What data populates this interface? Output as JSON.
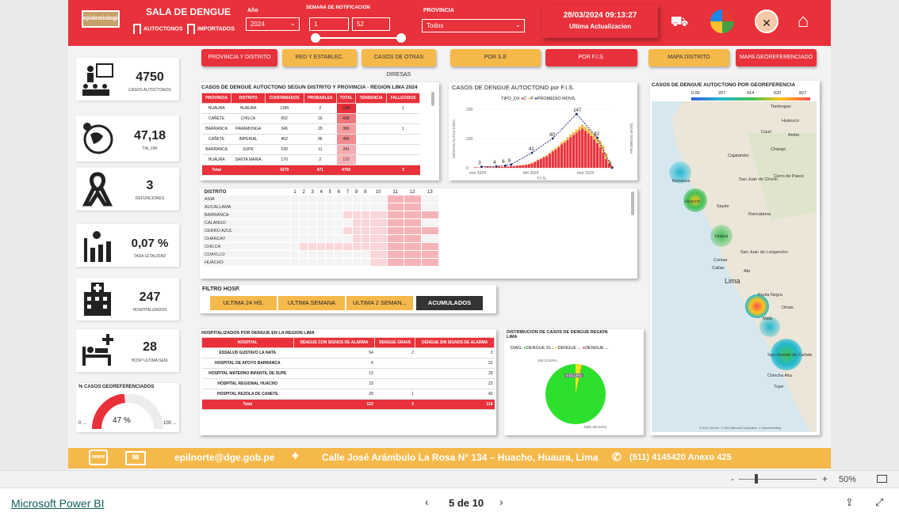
{
  "header": {
    "logo_text": "epidemiologia",
    "title": "SALA DE DENGUE",
    "filter_autoctonos": "AUTOCTONOS",
    "filter_importados": "IMPORTADOS",
    "year_label": "Año",
    "year_value": "2024",
    "week_label": "SEMANA DE NOTIFICACION",
    "week_from": "1",
    "week_to": "52",
    "province_label": "PROVINCIA",
    "province_value": "Todos",
    "datetime": "28/03/2024 09:13:27",
    "update_label": "Ultima Actualizacion"
  },
  "nav_buttons": [
    "PROVINCIA Y DISTRITO",
    "RED Y ESTABLEC.",
    "CASOS DE OTRAS DIRESAS",
    "POR S.E",
    "POR F.I.S.",
    "MAPA DISTRITO",
    "MAPA GEOREFERENCIADO"
  ],
  "kpis": {
    "casos": {
      "value": "4750",
      "label": "CASOS AUTOCTONOS"
    },
    "tia": {
      "value": "47,18",
      "label": "TIA_10K"
    },
    "defunciones": {
      "value": "3",
      "label": "DEFUNCIONES"
    },
    "letalidad": {
      "value": "0,07 %",
      "label": "TASA LETALIDAD"
    },
    "hospitalizados": {
      "value": "247",
      "label": "HOSPITALIZADOS"
    },
    "hosp_semana": {
      "value": "28",
      "label": "HOSP ULTIMA SEM."
    }
  },
  "georef": {
    "title": "% CASOS GEOREFERENCIADOS",
    "value": "47 %",
    "percent": 47,
    "min": "0 ...",
    "max": "100 ..."
  },
  "cases_table": {
    "title": "CASOS DE DENGUE AUTOCTONO SEGUN DISTRITO Y PROVINCIA - REGION LIMA 2024",
    "columns": [
      "PROVINCIA",
      "DISTRITO",
      "CONFIRMADOS",
      "PROBABLES",
      "TOTAL",
      "TENDENCIA",
      "FALLECIDOS"
    ],
    "rows": [
      [
        "HUAURA",
        "HUAURA",
        "1184",
        "2",
        "1186",
        "",
        "1"
      ],
      [
        "CAÑETE",
        "CHILCA",
        "652",
        "16",
        "668",
        "",
        ""
      ],
      [
        "BARRANCA",
        "PARAMONGA",
        "346",
        "20",
        "366",
        "",
        "1"
      ],
      [
        "CAÑETE",
        "IMPERIAL",
        "402",
        "96",
        "495",
        "",
        ""
      ],
      [
        "BARRANCA",
        "SUPE",
        "230",
        "11",
        "241",
        "",
        ""
      ],
      [
        "HUAURA",
        "SANTA MARIA",
        "170",
        "2",
        "172",
        "",
        ""
      ]
    ],
    "total": [
      "Total",
      "",
      "4279",
      "471",
      "4750",
      "",
      "3"
    ]
  },
  "fis_chart": {
    "title": "CASOS DE DENGUE AUTOCTONO por F.I.S.",
    "legend_label": "TIPO_DX",
    "legend_items": [
      "C",
      "P",
      "PROMEDIO MOVIL"
    ],
    "ylabel": "DENGUE AUTOCTONO",
    "y2label": "PROMEDIO MOVIL",
    "xlabel": "F.I.S.",
    "xticks": [
      "ene 2024",
      "feb 2024",
      "mar 2024"
    ]
  },
  "chart_data": {
    "type": "bar",
    "title": "CASOS DE DENGUE AUTOCTONO por F.I.S.",
    "xlabel": "F.I.S.",
    "ylabel": "DENGUE AUTOCTONO",
    "ylim": [
      0,
      200
    ],
    "yticks": [
      0,
      100,
      200
    ],
    "series": [
      {
        "name": "C",
        "color": "#e8313a",
        "values": [
          2,
          1,
          2,
          1,
          3,
          2,
          2,
          3,
          4,
          3,
          5,
          4,
          6,
          6,
          7,
          8,
          9,
          10,
          12,
          15,
          20,
          26,
          30,
          36,
          40,
          48,
          56,
          62,
          70,
          80,
          86,
          95,
          104,
          112,
          120,
          128,
          134,
          126,
          118,
          108,
          96,
          84,
          70,
          52,
          30,
          14,
          4
        ]
      },
      {
        "name": "P",
        "color": "#f5b94b",
        "values": [
          0,
          0,
          0,
          0,
          0,
          0,
          0,
          0,
          0,
          0,
          0,
          0,
          0,
          0,
          1,
          1,
          1,
          1,
          1,
          2,
          2,
          2,
          3,
          3,
          4,
          4,
          5,
          6,
          6,
          7,
          8,
          9,
          10,
          10,
          11,
          12,
          13,
          14,
          15,
          16,
          18,
          20,
          22,
          24,
          20,
          12,
          4
        ]
      },
      {
        "name": "PROMEDIO MOVIL",
        "color": "#1a2a6c",
        "values": [
          null,
          null,
          3,
          null,
          null,
          null,
          null,
          4,
          null,
          null,
          6,
          null,
          9,
          null,
          null,
          null,
          null,
          null,
          null,
          41,
          null,
          null,
          null,
          null,
          null,
          null,
          80,
          null,
          null,
          null,
          null,
          null,
          null,
          null,
          147,
          null,
          null,
          null,
          null,
          null,
          null,
          82,
          null,
          null,
          null,
          null,
          0
        ]
      }
    ],
    "data_labels": [
      3,
      4,
      6,
      9,
      41,
      80,
      147,
      82,
      0
    ]
  },
  "heatmap": {
    "header": "DISTRITO",
    "weeks": [
      "1",
      "2",
      "3",
      "4",
      "5",
      "6",
      "7",
      "8",
      "9",
      "10",
      "11",
      "12",
      "13"
    ],
    "districts": [
      "ASIA",
      "AUCALLAMA",
      "BARRANCA",
      "CALANGO",
      "CERRO AZUL",
      "CHANCAY",
      "CHILCA",
      "COAYLLO",
      "HUACHO"
    ]
  },
  "hosp_filter": {
    "title": "FILTRO HOSP.",
    "options": [
      "ULTIMA 24 HS.",
      "ULTIMA SEMANA",
      "ULTIMA 2 SEMAN...",
      "ACUMULADOS"
    ]
  },
  "hosp_table": {
    "title": "HOSPITALIZADOS POR DENGUE EN LA REGION LIMA",
    "columns": [
      "HOSPITAL",
      "DENGUE CON SIGNOS DE ALARMA",
      "DENGUE GRAVE",
      "DENGUE SIN SIGNOS DE ALARMA"
    ],
    "rows": [
      [
        "ESSALUD GUSTAVO LA NATA",
        "54",
        "2",
        "2"
      ],
      [
        "HOSPITAL DE APOYO BARRANCA",
        "4",
        "",
        "22"
      ],
      [
        "HOSPITAL MATERNO INFANTIL DE SUPE",
        "13",
        "",
        "29"
      ],
      [
        "HOSPITAL REGIONAL HUACHO",
        "23",
        "",
        "23"
      ],
      [
        "HOSPITAL REZOLA DE CANETE",
        "29",
        "1",
        "42"
      ]
    ],
    "total": [
      "Total",
      "123",
      "3",
      "118"
    ]
  },
  "pie": {
    "title": "DISTRIBUCION DE CASOS DE DENGUE REGION LIMA",
    "legend_label": "DIAG.",
    "legend_items": [
      "DENGUE SI...",
      "DENGUE ...",
      "DENGUE ..."
    ],
    "label_small": "158 (3,33%)",
    "label_center": "6 (0,13%)",
    "label_big": "4586 (96,55%)"
  },
  "map": {
    "title": "CASOS DE DENGUE AUTOCTONO POR GEOREFERENCIA",
    "scale": [
      "0.00",
      "207",
      "414",
      "620",
      "827"
    ],
    "places": [
      "Tambogan",
      "Huánuco",
      "Cauri",
      "Ambo",
      "Chango",
      "Cajatambo",
      "Cerro de Pasco",
      "Barranca",
      "San Juan de Churín",
      "Huacho",
      "Sayán",
      "Rancatama",
      "Huaral",
      "Comas",
      "San Juan de Lurigancho",
      "Callao",
      "Ate",
      "Lima",
      "Punta Negra",
      "Mala",
      "Omas",
      "San Vicente de Cañete",
      "Chincha Alta",
      "Tupe"
    ],
    "copyright": "© 2024 TomTom, © 2024 Microsoft Corporation, © OpenStreetMap"
  },
  "footer": {
    "email": "epilnorte@dge.gob.pe",
    "address": "Calle José Arámbulo La Rosa N° 134 – Huacho, Huaura, Lima",
    "phone": "(511) 4145420 Anexo 425"
  },
  "statusbar": {
    "zoom": "50%",
    "page": "5 de 10",
    "brand": "Microsoft Power BI"
  }
}
